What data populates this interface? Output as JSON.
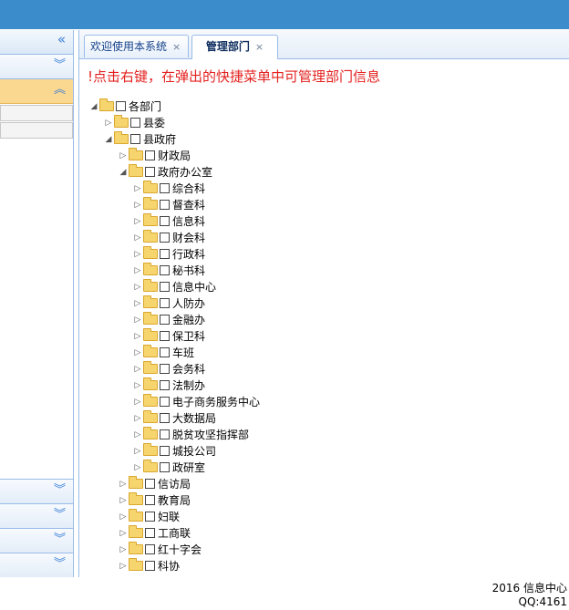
{
  "tabs": [
    {
      "label": "欢迎使用本系统",
      "close": "×"
    },
    {
      "label": "管理部门",
      "close": "×"
    }
  ],
  "left_panel": {
    "collapse_icon": "«",
    "expand_icon": "»"
  },
  "notice": "!点击右键，在弹出的快捷菜单中可管理部门信息",
  "tree": {
    "root": "各部门",
    "n1": "县委",
    "n2": "县政府",
    "n2_1": "财政局",
    "n2_2": "政府办公室",
    "n2_2_children": {
      "c1": "综合科",
      "c2": "督查科",
      "c3": "信息科",
      "c4": "财会科",
      "c5": "行政科",
      "c6": "秘书科",
      "c7": "信息中心",
      "c8": "人防办",
      "c9": "金融办",
      "c10": "保卫科",
      "c11": "车班",
      "c12": "会务科",
      "c13": "法制办",
      "c14": "电子商务服务中心",
      "c15": "大数据局",
      "c16": "脱贫攻坚指挥部",
      "c17": "城投公司",
      "c18": "政研室"
    },
    "n2_3": "信访局",
    "n2_4": "教育局",
    "n2_5": "妇联",
    "n2_6": "工商联",
    "n2_7": "红十字会",
    "n2_8": "科协"
  },
  "footer": {
    "line1": "2016 信息中心",
    "line2": "QQ:4161"
  }
}
